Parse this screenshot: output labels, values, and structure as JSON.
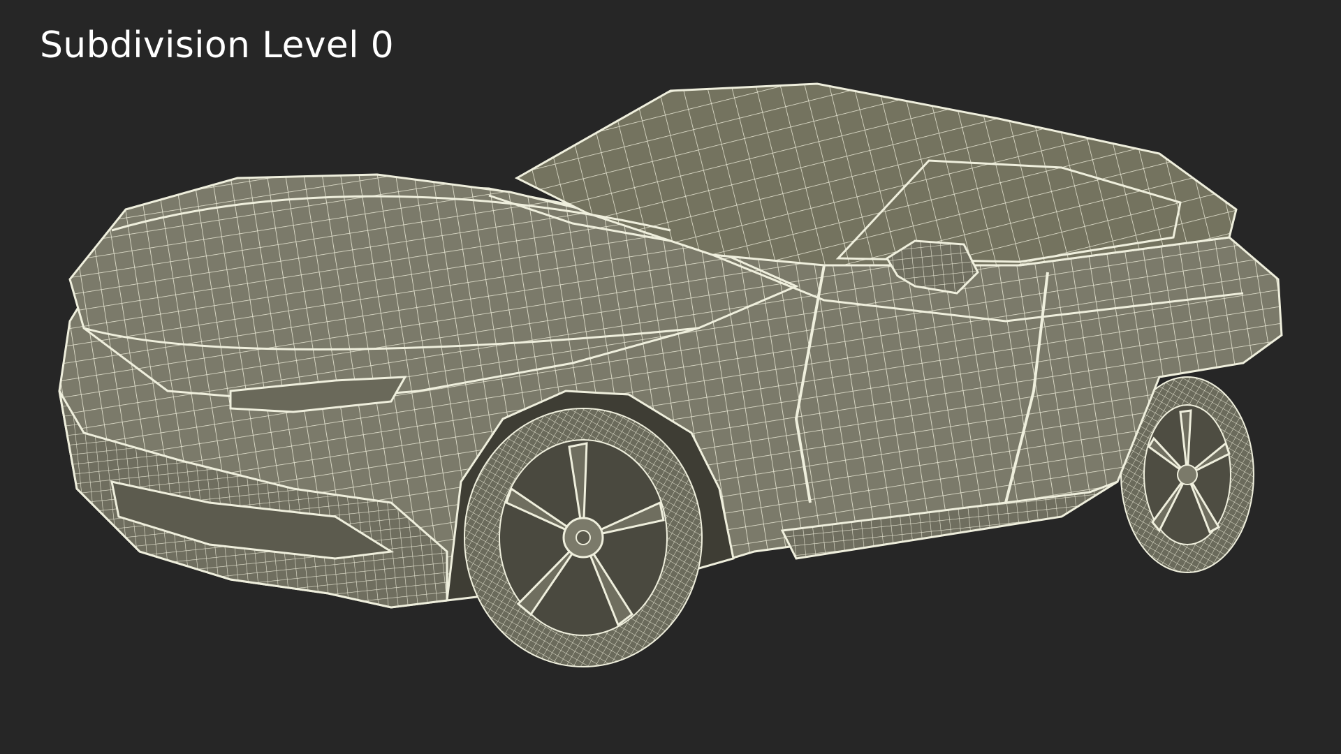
{
  "caption": "Subdivision Level 0",
  "colors": {
    "background": "#262626",
    "surface": "#7c7b6b",
    "surface_dark": "#5f5e50",
    "wire": "#efefdd",
    "caption": "#ffffff"
  },
  "render": {
    "subject": "car-wireframe-model"
  }
}
